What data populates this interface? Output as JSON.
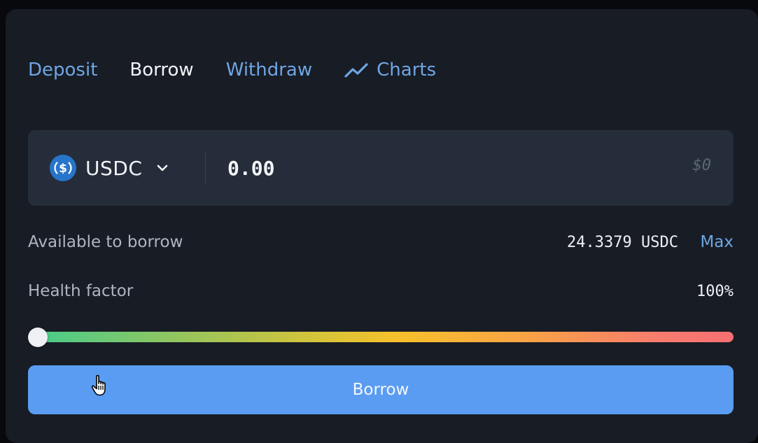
{
  "tabs": [
    {
      "label": "Deposit",
      "active": false
    },
    {
      "label": "Borrow",
      "active": true
    },
    {
      "label": "Withdraw",
      "active": false
    },
    {
      "label": "Charts",
      "active": false,
      "icon": "trend-line-icon"
    }
  ],
  "amount": {
    "token_symbol": "USDC",
    "token_icon": "usdc-logo-icon",
    "placeholder": "0.00",
    "usd_value": "$0"
  },
  "available": {
    "label": "Available to borrow",
    "value": "24.3379 USDC",
    "max_label": "Max"
  },
  "health": {
    "label": "Health factor",
    "value": "100%",
    "slider_level": 0
  },
  "action": {
    "button_label": "Borrow"
  },
  "colors": {
    "panel_bg": "#181c25",
    "accent_link": "#6ea6e4",
    "button_bg": "#5a9cf1",
    "gradient_start": "#45cc8c",
    "gradient_mid": "#f6c12b",
    "gradient_end": "#f86f73"
  }
}
